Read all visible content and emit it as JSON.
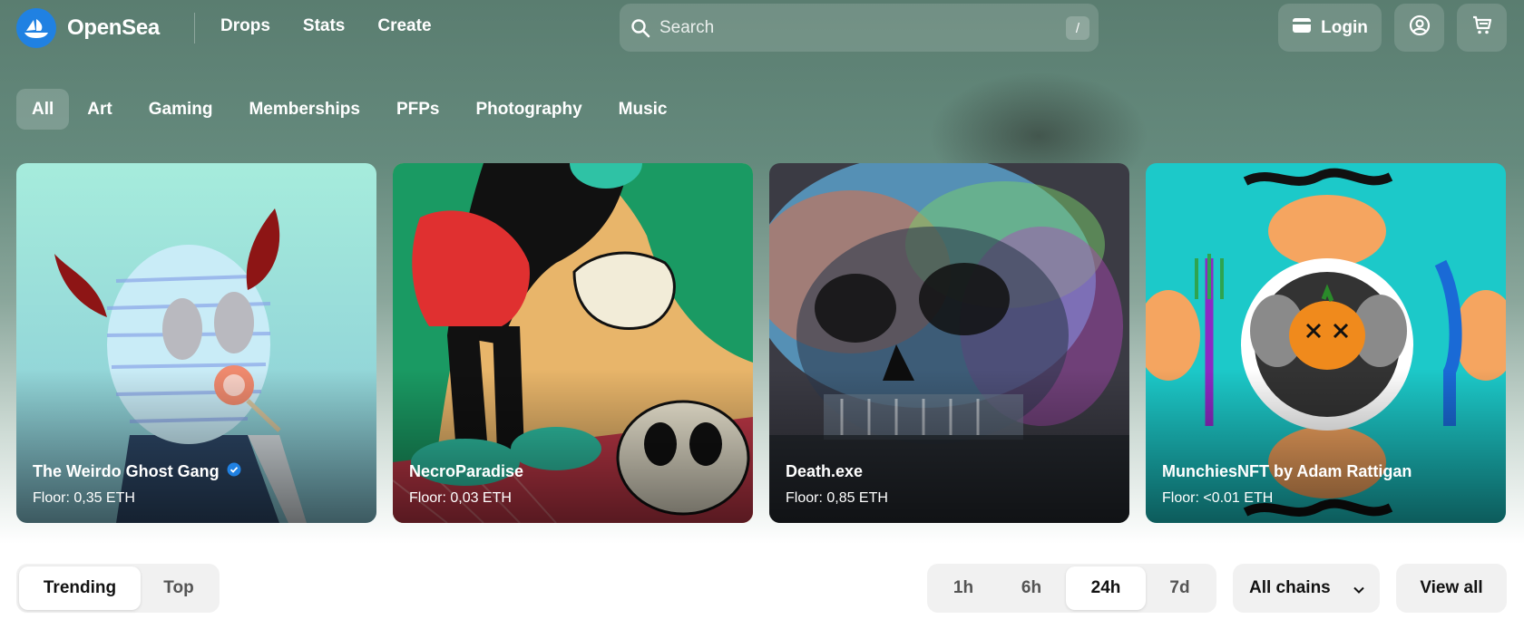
{
  "header": {
    "brand": "OpenSea",
    "nav": [
      "Drops",
      "Stats",
      "Create"
    ],
    "search_placeholder": "Search",
    "search_shortcut": "/",
    "login_label": "Login"
  },
  "categories": [
    "All",
    "Art",
    "Gaming",
    "Memberships",
    "PFPs",
    "Photography",
    "Music"
  ],
  "active_category": "All",
  "featured": [
    {
      "name": "The Weirdo Ghost Gang",
      "floor": "Floor: 0,35 ETH",
      "verified": true
    },
    {
      "name": "NecroParadise",
      "floor": "Floor: 0,03 ETH",
      "verified": false
    },
    {
      "name": "Death.exe",
      "floor": "Floor: 0,85 ETH",
      "verified": false
    },
    {
      "name": "MunchiesNFT by Adam Rattigan",
      "floor": "Floor: <0.01 ETH",
      "verified": false
    }
  ],
  "ranking_tabs": [
    "Trending",
    "Top"
  ],
  "active_ranking_tab": "Trending",
  "time_ranges": [
    "1h",
    "6h",
    "24h",
    "7d"
  ],
  "active_time_range": "24h",
  "chain_select": "All chains",
  "view_all_label": "View all",
  "colors": {
    "brand_blue": "#2081e2",
    "hero_top": "#5a7d70",
    "control_bg": "#f1f1f1"
  },
  "icons": [
    "opensea-logo-icon",
    "search-icon",
    "wallet-icon",
    "account-icon",
    "cart-icon",
    "verified-icon",
    "chevron-down-icon"
  ]
}
